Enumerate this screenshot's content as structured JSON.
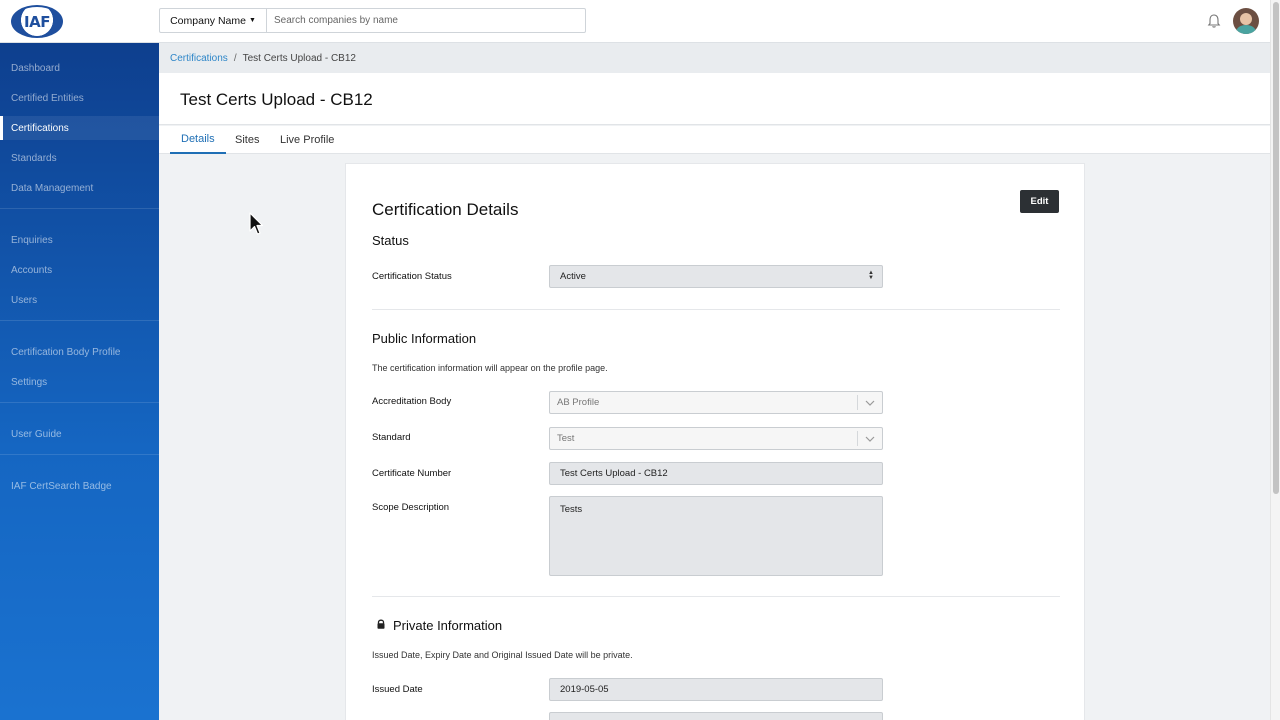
{
  "header": {
    "logo_text": "IAF",
    "search_select_label": "Company Name",
    "search_placeholder": "Search companies by name",
    "icons": {
      "notifications": "bell-icon",
      "avatar": "user-avatar"
    }
  },
  "sidebar": {
    "items": [
      {
        "label": "Dashboard",
        "active": false
      },
      {
        "label": "Certified Entities",
        "active": false
      },
      {
        "label": "Certifications",
        "active": true
      },
      {
        "label": "Standards",
        "active": false
      },
      {
        "label": "Data Management",
        "active": false
      },
      {
        "label": "Enquiries",
        "active": false
      },
      {
        "label": "Accounts",
        "active": false
      },
      {
        "label": "Users",
        "active": false
      },
      {
        "label": "Certification Body Profile",
        "active": false
      },
      {
        "label": "Settings",
        "active": false
      },
      {
        "label": "User Guide",
        "active": false
      },
      {
        "label": "IAF CertSearch Badge",
        "active": false
      }
    ]
  },
  "breadcrumb": {
    "parent": "Certifications",
    "separator": "/",
    "current": "Test Certs Upload - CB12"
  },
  "page": {
    "title": "Test Certs Upload - CB12"
  },
  "tabs": [
    {
      "label": "Details",
      "active": true
    },
    {
      "label": "Sites",
      "active": false
    },
    {
      "label": "Live Profile",
      "active": false
    }
  ],
  "card": {
    "title": "Certification Details",
    "edit_label": "Edit",
    "status_section": {
      "title": "Status",
      "status_label": "Certification Status",
      "status_value": "Active"
    },
    "public_section": {
      "title": "Public Information",
      "help": "The certification information will appear on the profile page.",
      "accreditation_label": "Accreditation Body",
      "accreditation_value": "AB Profile",
      "standard_label": "Standard",
      "standard_value": "Test",
      "cert_number_label": "Certificate Number",
      "cert_number_value": "Test Certs Upload - CB12",
      "scope_label": "Scope Description",
      "scope_value": "Tests"
    },
    "private_section": {
      "title": "Private Information",
      "help": "Issued Date, Expiry Date and Original Issued Date will be private.",
      "issued_label": "Issued Date",
      "issued_value": "2019-05-05"
    }
  },
  "colors": {
    "sidebar_top": "#0e3f8e",
    "sidebar_bottom": "#1a72d0",
    "link": "#2e86c8",
    "tab_active": "#1f6fb5",
    "edit_button": "#2c3034"
  }
}
